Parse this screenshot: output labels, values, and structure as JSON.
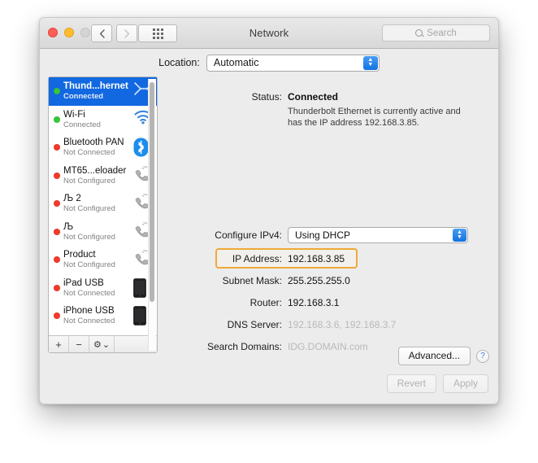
{
  "window": {
    "title": "Network",
    "traffic_lights": [
      "close",
      "minimize",
      "zoom"
    ],
    "nav_back_icon": "chevron-left-icon",
    "nav_forward_icon": "chevron-right-icon",
    "grid_icon": "show-all-grid-icon",
    "search_placeholder": "Search",
    "search_icon": "search-icon"
  },
  "location": {
    "label": "Location:",
    "value": "Automatic",
    "options": [
      "Automatic"
    ]
  },
  "sidebar": {
    "services": [
      {
        "name": "Thund...hernet",
        "status": "Connected",
        "dot": "green",
        "icon": "thunderbolt-icon",
        "selected": true
      },
      {
        "name": "Wi-Fi",
        "status": "Connected",
        "dot": "green",
        "icon": "wifi-icon",
        "selected": false
      },
      {
        "name": "Bluetooth PAN",
        "status": "Not Connected",
        "dot": "red",
        "icon": "bluetooth-icon",
        "selected": false
      },
      {
        "name": "MT65...eloader",
        "status": "Not Configured",
        "dot": "red",
        "icon": "modem-icon",
        "selected": false
      },
      {
        "name": "Љ 2",
        "status": "Not Configured",
        "dot": "red",
        "icon": "modem-icon",
        "selected": false
      },
      {
        "name": "Љ",
        "status": "Not Configured",
        "dot": "red",
        "icon": "modem-icon",
        "selected": false
      },
      {
        "name": "Product",
        "status": "Not Configured",
        "dot": "red",
        "icon": "modem-icon",
        "selected": false
      },
      {
        "name": "iPad USB",
        "status": "Not Connected",
        "dot": "red",
        "icon": "ipad-icon",
        "selected": false
      },
      {
        "name": "iPhone USB",
        "status": "Not Connected",
        "dot": "red",
        "icon": "iphone-icon",
        "selected": false
      }
    ],
    "footer": {
      "add_label": "+",
      "remove_label": "−",
      "gear_label": "⚙",
      "gear_caret": "⌄"
    }
  },
  "detail": {
    "status_label": "Status:",
    "status_value": "Connected",
    "status_description": "Thunderbolt Ethernet is currently active and has the IP address 192.168.3.85.",
    "configure_ipv4_label": "Configure IPv4:",
    "configure_ipv4_value": "Using DHCP",
    "ip_address_label": "IP Address:",
    "ip_address_value": "192.168.3.85",
    "subnet_mask_label": "Subnet Mask:",
    "subnet_mask_value": "255.255.255.0",
    "router_label": "Router:",
    "router_value": "192.168.3.1",
    "dns_server_label": "DNS Server:",
    "dns_server_value": "192.168.3.6, 192.168.3.7",
    "search_domains_label": "Search Domains:",
    "search_domains_value": "IDG.DOMAIN.com"
  },
  "actions": {
    "advanced_label": "Advanced...",
    "help_label": "?",
    "revert_label": "Revert",
    "apply_label": "Apply"
  },
  "colors": {
    "selection_blue": "#1168e0",
    "highlight_orange": "#f0a93a",
    "status_green": "#37c93d",
    "status_red": "#f43b2e",
    "window_chrome": "#ececec"
  }
}
